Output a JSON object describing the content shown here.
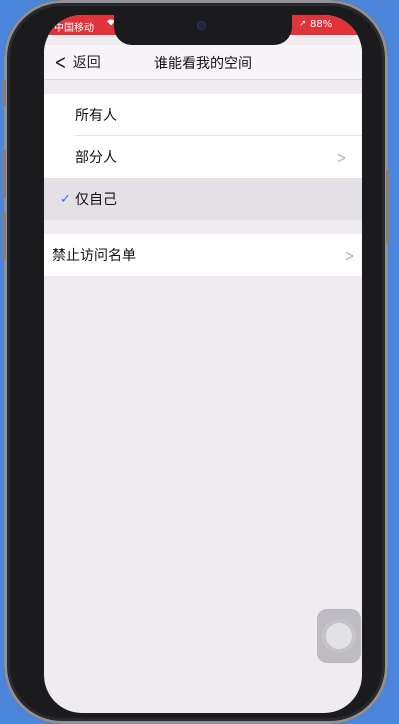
{
  "status_bar": {
    "carrier": "中国移动",
    "battery": "88%"
  },
  "nav": {
    "back_label": "返回",
    "title": "谁能看我的空间"
  },
  "options": [
    {
      "label": "所有人",
      "selected": false,
      "has_arrow": false
    },
    {
      "label": "部分人",
      "selected": false,
      "has_arrow": true
    },
    {
      "label": "仅自己",
      "selected": true,
      "has_arrow": false
    }
  ],
  "blocked": {
    "label": "禁止访问名单"
  },
  "colors": {
    "status_bar": "#e0343a",
    "check": "#2f6fe0",
    "background": "#efebf1"
  }
}
